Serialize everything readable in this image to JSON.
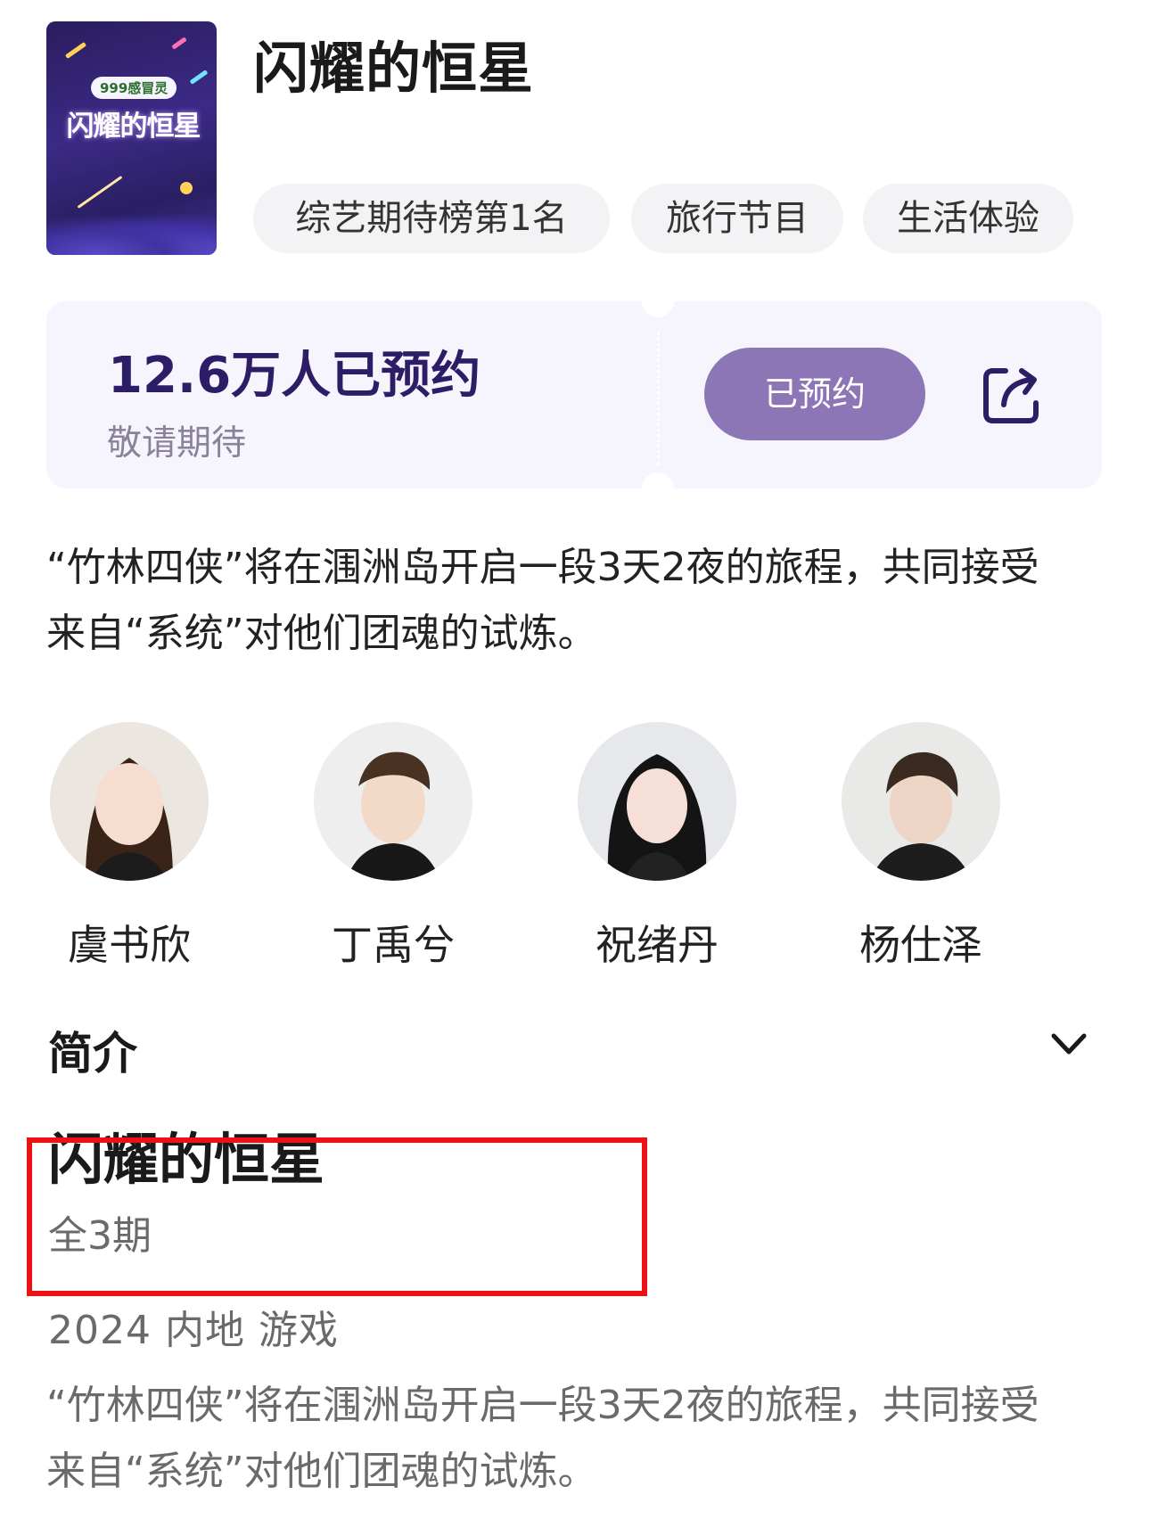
{
  "header": {
    "poster": {
      "badge": "999感冒灵",
      "title": "闪耀的恒星"
    },
    "title": "闪耀的恒星",
    "tags": [
      "综艺期待榜第1名",
      "旅行节目",
      "生活体验"
    ]
  },
  "booking": {
    "count_text": "12.6万人已预约",
    "subtitle": "敬请期待",
    "button_label": "已预约",
    "share_icon": "share-icon",
    "button_color": "#8c76b5",
    "count_color": "#2d1d66"
  },
  "description": {
    "line1": "“竹林四侠”将在涠洲岛开启一段3天2夜的旅程，共同接受",
    "line2": "来自“系统”对他们团魂的试炼。"
  },
  "cast": [
    {
      "name": "虞书欣"
    },
    {
      "name": "丁禹兮"
    },
    {
      "name": "祝绪丹"
    },
    {
      "name": "杨仕泽"
    }
  ],
  "intro": {
    "section_label": "简介",
    "toggle_icon": "chevron-down-icon",
    "title": "闪耀的恒星",
    "episodes": "全3期",
    "meta": "2024 内地 游戏",
    "line1": "“竹林四侠”将在涠洲岛开启一段3天2夜的旅程，共同接受",
    "line2": "来自“系统”对他们团魂的试炼。"
  },
  "highlight": {
    "color": "#ee1111"
  }
}
